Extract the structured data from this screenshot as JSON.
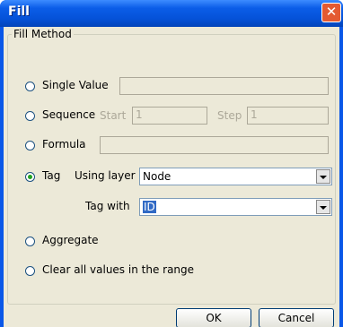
{
  "window": {
    "title": "Fill",
    "close_glyph": "✕"
  },
  "fill_method": {
    "legend": "Fill Method",
    "single_value": {
      "label": "Single Value",
      "value": ""
    },
    "sequence": {
      "label": "Sequence",
      "start_label": "Start",
      "start_value": "1",
      "step_label": "Step",
      "step_value": "1"
    },
    "formula": {
      "label": "Formula",
      "value": ""
    },
    "tag": {
      "label": "Tag",
      "using_layer_label": "Using layer",
      "layer_value": "Node",
      "tag_with_label": "Tag with",
      "tag_with_value": "ID",
      "selected": true
    },
    "aggregate": {
      "label": "Aggregate"
    },
    "clear": {
      "label": "Clear all values in the range"
    }
  },
  "buttons": {
    "ok": "OK",
    "cancel": "Cancel"
  }
}
